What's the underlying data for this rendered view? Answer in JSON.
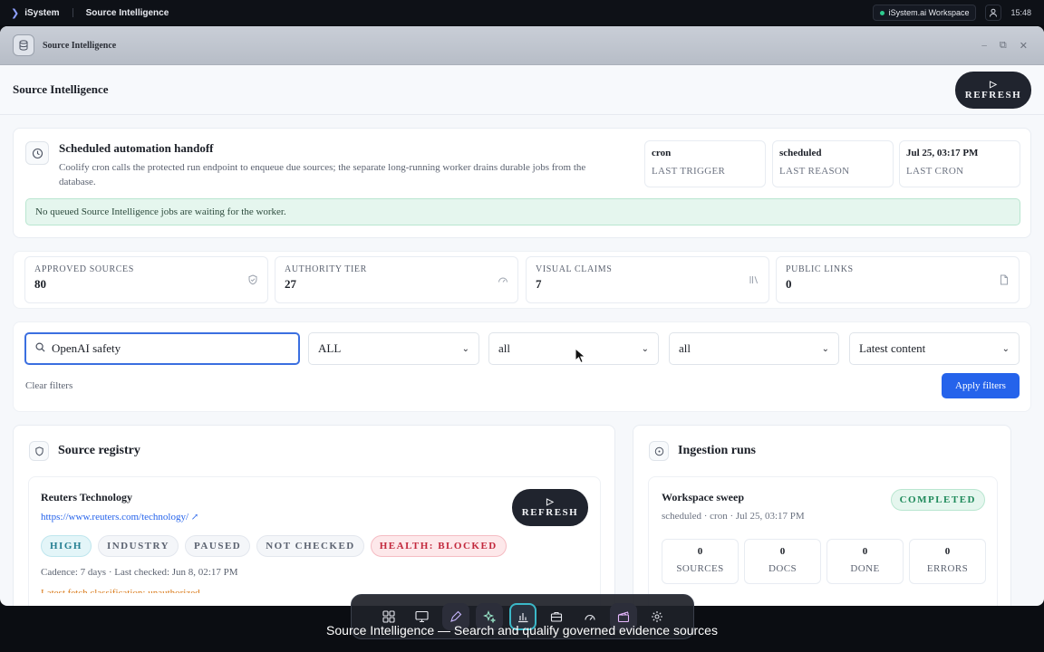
{
  "os": {
    "brand": "iSystem",
    "crumb": "Source Intelligence",
    "workspace": "iSystem.ai Workspace",
    "time": "15:48"
  },
  "window": {
    "title": "Source Intelligence"
  },
  "header": {
    "title": "Source Intelligence",
    "refresh_label": "REFRESH"
  },
  "automation": {
    "title": "Scheduled automation handoff",
    "description": "Coolify cron calls the protected run endpoint to enqueue due sources; the separate long-running worker drains durable jobs from the database.",
    "stats": [
      {
        "value": "cron",
        "label": "LAST TRIGGER"
      },
      {
        "value": "scheduled",
        "label": "LAST REASON"
      },
      {
        "value": "Jul 25, 03:17 PM",
        "label": "LAST CRON"
      }
    ],
    "notice": "No queued Source Intelligence jobs are waiting for the worker."
  },
  "metrics": [
    {
      "label": "APPROVED SOURCES",
      "value": "80",
      "icon": "shield-check-icon"
    },
    {
      "label": "AUTHORITY TIER",
      "value": "27",
      "icon": "gauge-icon"
    },
    {
      "label": "VISUAL CLAIMS",
      "value": "7",
      "icon": "library-icon"
    },
    {
      "label": "PUBLIC LINKS",
      "value": "0",
      "icon": "document-icon"
    }
  ],
  "filters": {
    "search_value": "OpenAI safety",
    "selects": [
      "ALL",
      "all",
      "all",
      "Latest content"
    ],
    "clear_label": "Clear filters",
    "apply_label": "Apply filters"
  },
  "registry": {
    "title": "Source registry",
    "item": {
      "name": "Reuters Technology",
      "url": "https://www.reuters.com/technology/",
      "refresh_label": "REFRESH",
      "badges": [
        "HIGH",
        "INDUSTRY",
        "PAUSED",
        "NOT CHECKED",
        "HEALTH: BLOCKED"
      ],
      "cadence": "Cadence: 7 days · Last checked: Jun 8, 02:17 PM",
      "note": "Latest fetch classification: unauthorized"
    }
  },
  "runs": {
    "title": "Ingestion runs",
    "item": {
      "name": "Workspace sweep",
      "meta": "scheduled · cron · Jul 25, 03:17 PM",
      "status": "COMPLETED",
      "stats": [
        {
          "value": "0",
          "label": "SOURCES"
        },
        {
          "value": "0",
          "label": "DOCS"
        },
        {
          "value": "0",
          "label": "DONE"
        },
        {
          "value": "0",
          "label": "ERRORS"
        }
      ]
    }
  },
  "caption": "Source Intelligence — Search and qualify governed evidence sources",
  "colors": {
    "accent": "#2563eb",
    "dark_button": "#20242e",
    "success": "#1f8a5b",
    "danger": "#c2283c"
  }
}
